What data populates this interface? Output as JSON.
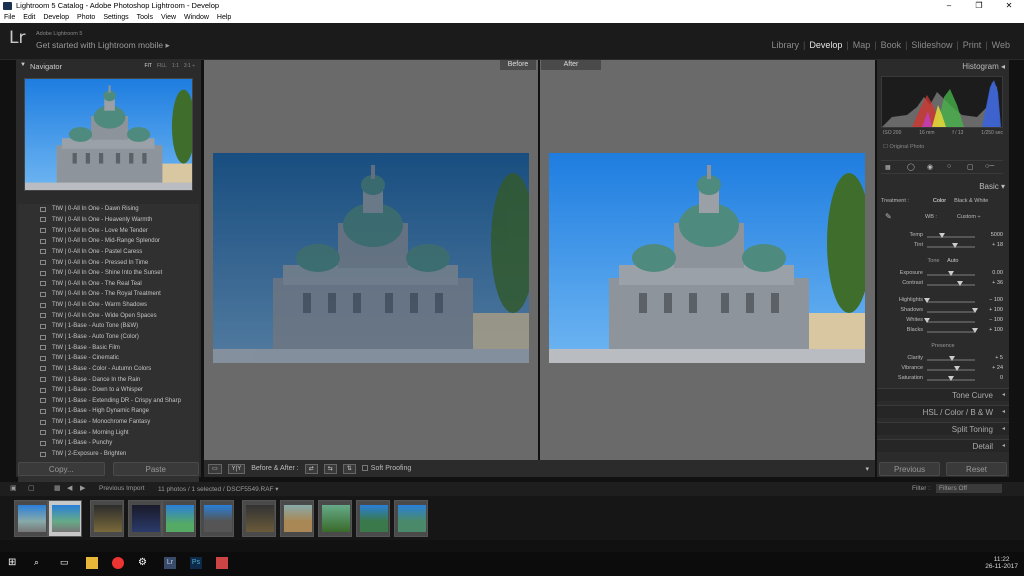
{
  "window": {
    "title": "Lightroom 5 Catalog - Adobe Photoshop Lightroom - Develop",
    "controls": [
      "–",
      "❐",
      "✕"
    ]
  },
  "menu": [
    "File",
    "Edit",
    "Develop",
    "Photo",
    "Settings",
    "Tools",
    "View",
    "Window",
    "Help"
  ],
  "header": {
    "logo": "Lr",
    "version": "Adobe Lightroom 5",
    "mobile": "Get started with Lightroom mobile ▸"
  },
  "modules": [
    "Library",
    "Develop",
    "Map",
    "Book",
    "Slideshow",
    "Print",
    "Web"
  ],
  "navigator": {
    "title": "Navigator",
    "zoom": [
      "FIT",
      "FILL",
      "1:1",
      "3:1 ÷"
    ]
  },
  "presets": [
    "TtW | 0-All In One - Dawn Rising",
    "TtW | 0-All In One - Heavenly Warmth",
    "TtW | 0-All In One - Love Me Tender",
    "TtW | 0-All In One - Mid-Range Splendor",
    "TtW | 0-All In One - Pastel Caress",
    "TtW | 0-All In One - Pressed In Time",
    "TtW | 0-All In One - Shine Into the Sunset",
    "TtW | 0-All In One - The Real Teal",
    "TtW | 0-All In One - The Royal Treatment",
    "TtW | 0-All In One - Warm Shadows",
    "TtW | 0-All In One - Wide Open Spaces",
    "TtW | 1-Base - Auto Tone (B&W)",
    "TtW | 1-Base - Auto Tone (Color)",
    "TtW | 1-Base - Basic Film",
    "TtW | 1-Base - Cinematic",
    "TtW | 1-Base - Color - Autumn Colors",
    "TtW | 1-Base - Dance In the Rain",
    "TtW | 1-Base - Down to a Whisper",
    "TtW | 1-Base - Extending DR - Crispy and Sharp",
    "TtW | 1-Base - High Dynamic Range",
    "TtW | 1-Base - Monochrome Fantasy",
    "TtW | 1-Base - Morning Light",
    "TtW | 1-Base - Punchy",
    "TtW | 2-Exposure - Brighten"
  ],
  "left_buttons": {
    "copy": "Copy...",
    "paste": "Paste"
  },
  "view": {
    "before": "Before",
    "after": "After"
  },
  "toolbar": {
    "yy": "Y|Y",
    "before_after": "Before & After :",
    "soft_proofing": "Soft Proofing"
  },
  "histogram": {
    "title": "Histogram",
    "iso": "ISO 200",
    "focal": "16 mm",
    "aperture": "f / 13",
    "shutter": "1/250 sec",
    "original": "Original Photo"
  },
  "basic": {
    "title": "Basic",
    "treatment_label": "Treatment :",
    "treatment_color": "Color",
    "treatment_bw": "Black & White",
    "wb_label": "WB :",
    "wb_value": "Custom ÷",
    "tone_label": "Tone",
    "auto_label": "Auto",
    "presence_label": "Presence",
    "sliders": [
      {
        "label": "Temp",
        "value": "5000",
        "level": 0.32
      },
      {
        "label": "Tint",
        "value": "+ 18",
        "level": 0.58
      },
      {
        "label": "Exposure",
        "value": "0.00",
        "level": 0.5
      },
      {
        "label": "Contrast",
        "value": "+ 36",
        "level": 0.68
      },
      {
        "label": "Highlights",
        "value": "− 100",
        "level": 0.0
      },
      {
        "label": "Shadows",
        "value": "+ 100",
        "level": 1.0
      },
      {
        "label": "Whites",
        "value": "− 100",
        "level": 0.0
      },
      {
        "label": "Blacks",
        "value": "+ 100",
        "level": 1.0
      },
      {
        "label": "Clarity",
        "value": "+ 5",
        "level": 0.52
      },
      {
        "label": "Vibrance",
        "value": "+ 24",
        "level": 0.62
      },
      {
        "label": "Saturation",
        "value": "0",
        "level": 0.5
      }
    ]
  },
  "collapsed_panels": [
    "Tone Curve",
    "HSL  /  Color  /  B & W",
    "Split Toning",
    "Detail"
  ],
  "right_buttons": {
    "previous": "Previous",
    "reset": "Reset"
  },
  "filmbar": {
    "source": "Previous Import",
    "count": "11 photos / 1 selected / DSCF5549.RAF ▾",
    "filter_label": "Filter :",
    "filter_value": "Filters Off"
  },
  "taskbar": {
    "time": "11:22",
    "date": "26-11-2017"
  },
  "colors": {
    "sky": "#2a7fd8",
    "panel": "#2b2b2b",
    "center": "#6a6a6a"
  }
}
